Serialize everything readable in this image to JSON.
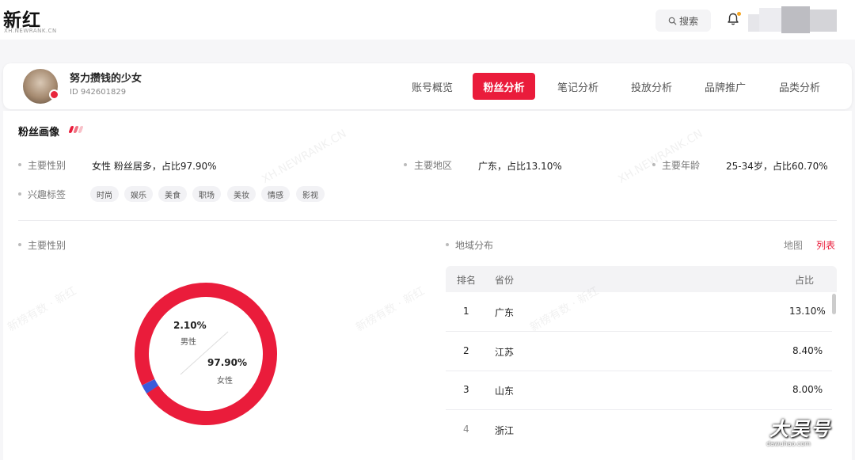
{
  "brand": {
    "name": "新红",
    "sub": "XH.NEWRANK.CN"
  },
  "header": {
    "search_label": "搜索"
  },
  "account": {
    "name": "努力攒钱的少女",
    "id": "ID 942601829"
  },
  "tabs": [
    {
      "label": "账号概览",
      "active": false
    },
    {
      "label": "粉丝分析",
      "active": true
    },
    {
      "label": "笔记分析",
      "active": false
    },
    {
      "label": "投放分析",
      "active": false
    },
    {
      "label": "品牌推广",
      "active": false
    },
    {
      "label": "品类分析",
      "active": false
    }
  ],
  "portrait": {
    "title": "粉丝画像",
    "gender_label": "主要性别",
    "gender_value": "女性 粉丝居多，占比97.90%",
    "region_label": "主要地区",
    "region_value": "广东，占比13.10%",
    "age_label": "主要年龄",
    "age_value": "25-34岁，占比60.70%",
    "interest_label": "兴趣标签",
    "tags": [
      "时尚",
      "娱乐",
      "美食",
      "职场",
      "美妆",
      "情感",
      "影视"
    ]
  },
  "gender_chart": {
    "title": "主要性别",
    "male_pct": "2.10%",
    "male_label": "男性",
    "female_pct": "97.90%",
    "female_label": "女性",
    "male_value": 2.1,
    "female_value": 97.9,
    "male_color": "#3b5bdb",
    "female_color": "#ea1c3b"
  },
  "region": {
    "title": "地域分布",
    "toggle_map": "地图",
    "toggle_list": "列表",
    "columns": [
      "排名",
      "省份",
      "占比"
    ],
    "rows": [
      {
        "rank": "1",
        "province": "广东",
        "pct": "13.10%"
      },
      {
        "rank": "2",
        "province": "江苏",
        "pct": "8.40%"
      },
      {
        "rank": "3",
        "province": "山东",
        "pct": "8.00%"
      },
      {
        "rank": "4",
        "province": "浙江",
        "pct": ""
      }
    ]
  },
  "watermarks": {
    "site": "XH.NEWRANK.CN",
    "text": "新榜有数 · 新红"
  },
  "corner_watermark": {
    "big": "大吴号",
    "small": "dawuhao.com"
  },
  "colors": {
    "accent": "#ea1c3b",
    "male": "#3b5bdb"
  }
}
